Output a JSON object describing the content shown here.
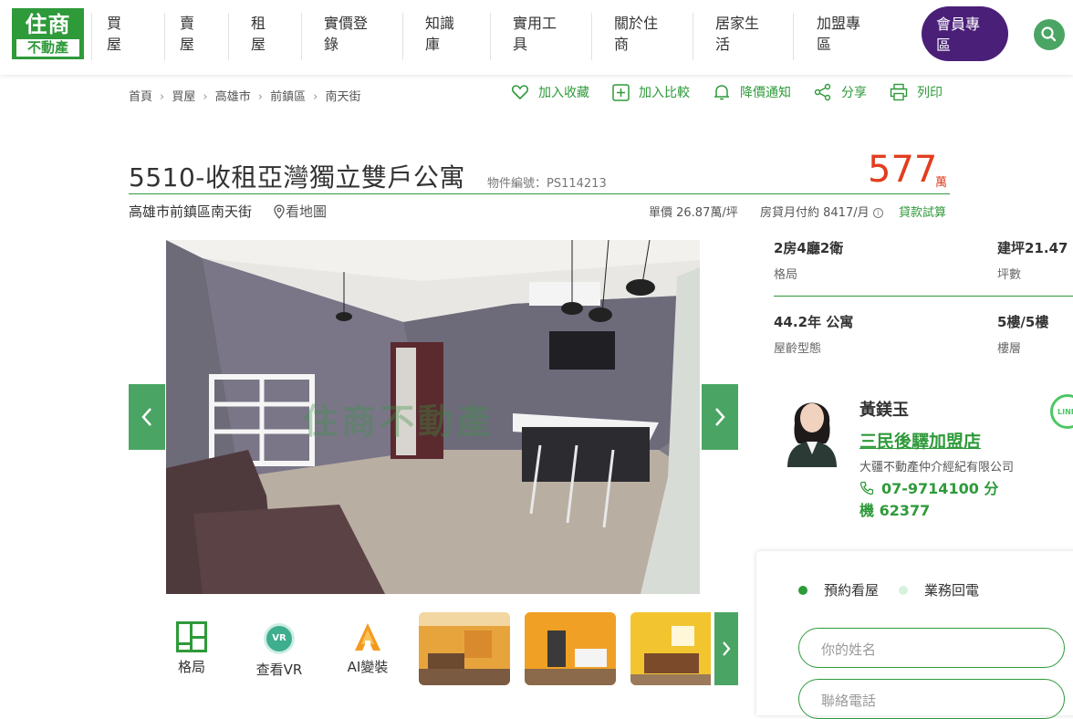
{
  "logo": {
    "top": "住商",
    "bottom": "不動產"
  },
  "nav": [
    {
      "line1": "買",
      "line2": "屋"
    },
    {
      "line1": "賣",
      "line2": "屋"
    },
    {
      "line1": "租",
      "line2": "屋"
    },
    {
      "line1": "實價登",
      "line2": "錄"
    },
    {
      "line1": "知識",
      "line2": "庫"
    },
    {
      "line1": "實用工",
      "line2": "具"
    },
    {
      "line1": "關於住",
      "line2": "商"
    },
    {
      "line1": "居家生",
      "line2": "活"
    },
    {
      "line1": "加盟專",
      "line2": "區"
    }
  ],
  "member": {
    "line1": "會員專",
    "line2": "區"
  },
  "breadcrumb": [
    "首頁",
    "買屋",
    "高雄市",
    "前鎮區",
    "南天街"
  ],
  "actions": {
    "favorite": "加入收藏",
    "compare": "加入比較",
    "notify": "降價通知",
    "share": "分享",
    "print": "列印"
  },
  "listing": {
    "title": "5510-收租亞灣獨立雙戶公寓",
    "object_no": "物件編號：PS114213",
    "price": "577",
    "price_unit": "萬",
    "address": "高雄市前鎮區南天街",
    "map_link": "看地圖",
    "unit_price": "單價  26.87萬/坪",
    "monthly": "房貸月付約  8417/月",
    "loan": "貸款試算"
  },
  "photo": {
    "watermark": "住商不動產"
  },
  "tools": {
    "layout": "格局",
    "vr": "查看VR",
    "vr_badge": "VR",
    "ai": "AI變裝"
  },
  "specs": {
    "rooms": {
      "value": "2房4廳2衛",
      "label": "格局"
    },
    "area": {
      "value": "建坪21.47",
      "label": "坪數"
    },
    "age": {
      "value": "44.2年 公寓",
      "label": "屋齡型態"
    },
    "floor": {
      "value": "5樓/5樓",
      "label": "樓層"
    }
  },
  "agent": {
    "name": "黃鎂玉",
    "store": "三民後驛加盟店",
    "company": "大疆不動產仲介經紀有限公司",
    "phone": "07-9714100 分機 62377",
    "line_badge": "LINE"
  },
  "booking": {
    "tab_visit": "預約看屋",
    "tab_callback": "業務回電",
    "name_placeholder": "你的姓名",
    "phone_placeholder": "聯絡電話"
  },
  "colors": {
    "brand_green": "#2e9a3a",
    "price_red": "#e23d1e",
    "member_purple": "#4a1f78"
  }
}
